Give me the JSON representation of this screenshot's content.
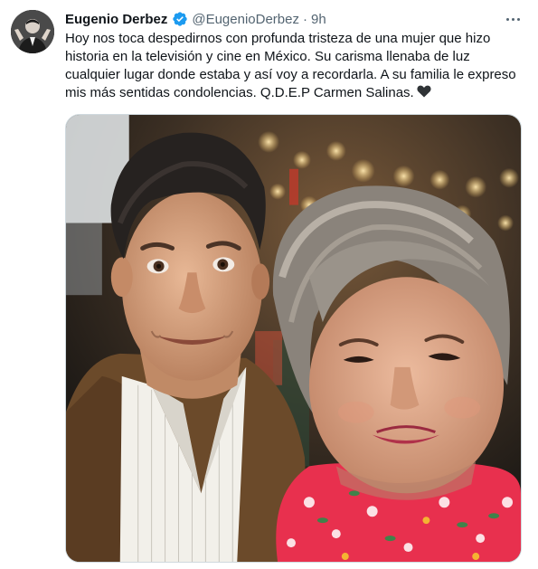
{
  "tweet": {
    "author_name": "Eugenio Derbez",
    "handle": "@EugenioDerbez",
    "separator": "·",
    "time": "9h",
    "text": "Hoy nos toca despedirnos con profunda tristeza de una mujer que hizo historia en la televisión y cine en México. Su carisma llenaba de luz cualquier lugar donde estaba y así voy a recordarla. A su familia le expreso mis más sentidas condolencias. Q.D.E.P Carmen Salinas.",
    "verified_icon": "verified-badge-icon",
    "more_icon": "more-options-icon",
    "heart_icon": "black-heart-emoji"
  },
  "colors": {
    "verified_blue": "#1d9bf0",
    "secondary_text": "#536471",
    "primary_text": "#0f1419"
  }
}
